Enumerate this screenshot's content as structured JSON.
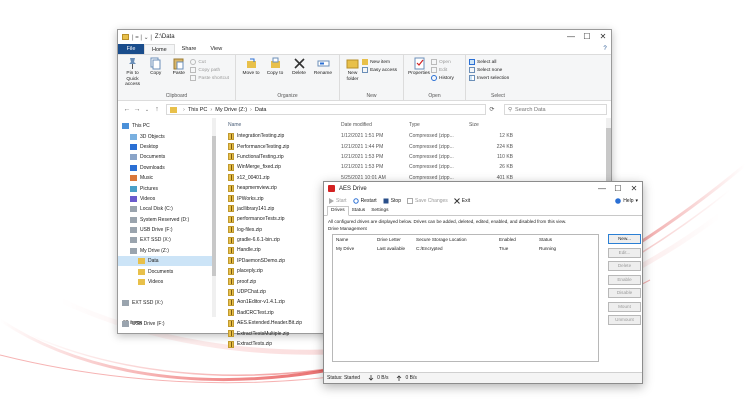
{
  "explorer": {
    "title": "Z:\\Data",
    "quick_access": "| = | ⌄ |",
    "window_controls": [
      "—",
      "☐",
      "✕"
    ],
    "tabs": [
      "File",
      "Home",
      "Share",
      "View"
    ],
    "help": "?",
    "ribbon": {
      "pin": "Pin to Quick access",
      "copy": "Copy",
      "paste": "Paste",
      "cut": "Cut",
      "copy_path": "Copy path",
      "paste_shortcut": "Paste shortcut",
      "clipboard": "Clipboard",
      "move_to": "Move to",
      "copy_to": "Copy to",
      "delete": "Delete",
      "rename": "Rename",
      "organize": "Organize",
      "new_folder": "New folder",
      "new_item": "New item",
      "easy_access": "Easy access",
      "new_group": "New",
      "properties": "Properties",
      "open": "Open",
      "edit": "Edit",
      "history": "History",
      "open_group": "Open",
      "select_all": "Select all",
      "select_none": "Select none",
      "invert_selection": "Invert selection",
      "select_group": "Select"
    },
    "address": {
      "path": [
        "This PC",
        "My Drive (Z:)",
        "Data"
      ],
      "search_placeholder": "Search Data"
    },
    "nav": [
      {
        "label": "This PC",
        "indent": 0,
        "icon": "pc"
      },
      {
        "label": "3D Objects",
        "indent": 1,
        "icon": "cube"
      },
      {
        "label": "Desktop",
        "indent": 1,
        "icon": "desktop"
      },
      {
        "label": "Documents",
        "indent": 1,
        "icon": "doc"
      },
      {
        "label": "Downloads",
        "indent": 1,
        "icon": "download"
      },
      {
        "label": "Music",
        "indent": 1,
        "icon": "music"
      },
      {
        "label": "Pictures",
        "indent": 1,
        "icon": "picture"
      },
      {
        "label": "Videos",
        "indent": 1,
        "icon": "video"
      },
      {
        "label": "Local Disk (C:)",
        "indent": 1,
        "icon": "drive"
      },
      {
        "label": "System Reserved (D:)",
        "indent": 1,
        "icon": "drive"
      },
      {
        "label": "USB Drive (F:)",
        "indent": 1,
        "icon": "drive"
      },
      {
        "label": "EXT SSD (X:)",
        "indent": 1,
        "icon": "drive"
      },
      {
        "label": "My Drive (Z:)",
        "indent": 1,
        "icon": "drive"
      },
      {
        "label": "Data",
        "indent": 2,
        "icon": "folder",
        "selected": true
      },
      {
        "label": "Documents",
        "indent": 2,
        "icon": "folder"
      },
      {
        "label": "Videos",
        "indent": 2,
        "icon": "folder"
      },
      {
        "label": "",
        "indent": 0,
        "icon": "none"
      },
      {
        "label": "EXT SSD (X:)",
        "indent": 0,
        "icon": "drive"
      },
      {
        "label": "",
        "indent": 0,
        "icon": "none"
      },
      {
        "label": "USB Drive (F:)",
        "indent": 0,
        "icon": "drive"
      }
    ],
    "columns": [
      "Name",
      "Date modified",
      "Type",
      "Size"
    ],
    "files": [
      {
        "name": "IntegrationTesting.zip",
        "date": "1/12/2021 1:51 PM",
        "type": "Compressed (zipp...",
        "size": "12 KB"
      },
      {
        "name": "PerformanceTesting.zip",
        "date": "1/21/2021 1:44 PM",
        "type": "Compressed (zipp...",
        "size": "224 KB"
      },
      {
        "name": "FunctionalTesting.zip",
        "date": "1/21/2021 1:53 PM",
        "type": "Compressed (zipp...",
        "size": "110 KB"
      },
      {
        "name": "WinMerge_fixed.zip",
        "date": "1/21/2021 1:53 PM",
        "type": "Compressed (zipp...",
        "size": "26 KB"
      },
      {
        "name": "x12_00401.zip",
        "date": "5/25/2021 10:01 AM",
        "type": "Compressed (zipp...",
        "size": "401 KB"
      },
      {
        "name": "heapmemview.zip",
        "date": "1/21/2021 1:53 PM",
        "type": "Compressed (zipp...",
        "size": "29 KB"
      },
      {
        "name": "IPWorks.zip",
        "date": "",
        "type": "",
        "size": ""
      },
      {
        "name": "jacllibrary141.zip",
        "date": "",
        "type": "",
        "size": ""
      },
      {
        "name": "performanceTests.zip",
        "date": "",
        "type": "",
        "size": ""
      },
      {
        "name": "log-files.zip",
        "date": "",
        "type": "",
        "size": ""
      },
      {
        "name": "gradle-6.6.1-bin.zip",
        "date": "",
        "type": "",
        "size": ""
      },
      {
        "name": "Handle.zip",
        "date": "",
        "type": "",
        "size": ""
      },
      {
        "name": "IPDaemonSDemo.zip",
        "date": "",
        "type": "",
        "size": ""
      },
      {
        "name": "placeply.zip",
        "date": "",
        "type": "",
        "size": ""
      },
      {
        "name": "proof.zip",
        "date": "",
        "type": "",
        "size": ""
      },
      {
        "name": "UDPChat.zip",
        "date": "",
        "type": "",
        "size": ""
      },
      {
        "name": "Aon1Editor-v1.4.1.zip",
        "date": "",
        "type": "",
        "size": ""
      },
      {
        "name": "BadCRCTest.zip",
        "date": "",
        "type": "",
        "size": ""
      },
      {
        "name": "AES.Extended.Header.Bit.zip",
        "date": "",
        "type": "",
        "size": ""
      },
      {
        "name": "ExtractTestsMultiple.zip",
        "date": "",
        "type": "",
        "size": ""
      },
      {
        "name": "ExtractTests.zip",
        "date": "",
        "type": "",
        "size": ""
      }
    ],
    "status": "22 items"
  },
  "aes": {
    "title": "AES Drive",
    "window_controls": [
      "—",
      "☐",
      "✕"
    ],
    "toolbar": [
      "Start",
      "Restart",
      "Stop",
      "Save Changes",
      "Exit"
    ],
    "help": "Help",
    "tabs": [
      "Drives",
      "Status",
      "Settings"
    ],
    "description": "All configured drives are displayed below. Drives can be added, deleted, edited, enabled, and disabled from this view.",
    "section": "Drive Management",
    "columns": [
      "Name",
      "Drive Letter",
      "Secure Storage Location",
      "Enabled",
      "Status"
    ],
    "drives": [
      {
        "name": "My Drive",
        "letter": "Last available",
        "location": "C:/Encrypted",
        "enabled": "True",
        "status": "Running"
      }
    ],
    "buttons": [
      "New...",
      "Edit...",
      "Delete",
      "Enable",
      "Disable",
      "Mount",
      "Unmount"
    ],
    "status_bar": {
      "status": "Status: Started",
      "down": "0 B/s",
      "up": "0 B/s"
    }
  },
  "colors": {
    "accent": "#1a4d8c",
    "folder": "#e8c04a",
    "aes_red": "#d32222"
  }
}
